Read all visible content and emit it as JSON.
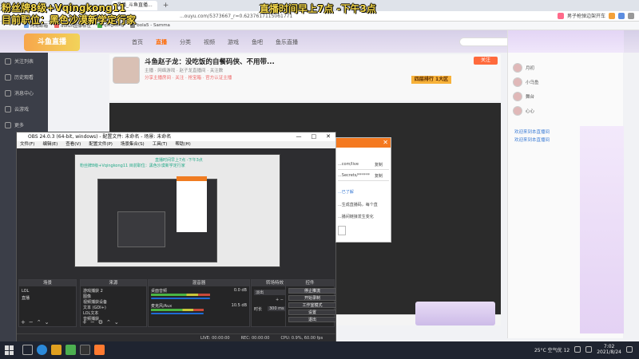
{
  "overlays": {
    "line1": "粉丝牌8级+Vqingkong11",
    "line2": "目前职位：黑色沙漠新学定行家",
    "line3": "直播时间早上7点 -下午3点"
  },
  "browser": {
    "tabs": [
      "混播_斗鱼直播...",
      "+"
    ],
    "url": "...ouyu.com/5373667_r=0.6237617115061771",
    "toolbar_items": [
      "男子枪弹边架开车"
    ],
    "bookmarks": [
      "网易邮箱",
      "dufun图像标注",
      "qingkong",
      "bola5 - Samma"
    ]
  },
  "site": {
    "logo": "斗鱼直播",
    "nav": [
      "首页",
      "直播",
      "分类",
      "视频",
      "游戏",
      "鱼吧",
      "鱼乐直播"
    ],
    "nav_active": 1,
    "left_nav": [
      "关注列表",
      "历史观看",
      "消息中心",
      "云游戏",
      "更多"
    ],
    "room": {
      "title": "斗鱼赵子龙：没吃饭的自餐码侠、不用带...",
      "sub": "主播 · 网络游戏 · 赵子龙直播间 · 关注数",
      "sub2": "分享主播房间 · 关注 · 抢宝箱 · 官方认证主播",
      "follow": "关注",
      "rank": "四层排行 1大区"
    },
    "chat": {
      "ranks": [
        "月初",
        "小乌鱼",
        "舞台",
        "心心"
      ],
      "lines": [
        {
          "user": "欢迎来到本直播间",
          "text": ""
        },
        {
          "user": "欢迎来到本直播间",
          "text": ""
        }
      ]
    }
  },
  "obs": {
    "title": "OBS 24.0.3 (64-bit, windows) - 配置文件: 未命名 - 场景: 未命名",
    "menu": [
      "文件(F)",
      "编辑(E)",
      "查看(V)",
      "配置文件(P)",
      "场景集合(S)",
      "工具(T)",
      "帮助(H)"
    ],
    "preview_text1": "直播时间早上7点 -下午3点",
    "preview_text2": "粉丝牌8级+Vqingkong11 目前职位：黑色沙漠新学定行家",
    "docks": {
      "scenes": {
        "title": "场景",
        "items": [
          "LOL",
          "直播"
        ]
      },
      "sources": {
        "title": "来源",
        "items": [
          "游戏捕获 2",
          "图像",
          "视频捕获设备",
          "文本 (GDI+)",
          "LOL文本",
          "音频捕获"
        ]
      },
      "mixer": {
        "title": "混音器",
        "channels": [
          {
            "name": "桌面音频",
            "db": "0.0 dB",
            "level": 0.62
          },
          {
            "name": "麦克风/Aux",
            "db": "10.5 dB",
            "level": 0.55
          }
        ]
      },
      "transitions": {
        "title": "转场特效",
        "type": "淡出",
        "duration_label": "时长",
        "duration": "300 ms"
      },
      "controls": {
        "title": "控件",
        "buttons": [
          "停止推流",
          "开始录制",
          "工作室模式",
          "设置",
          "退出"
        ]
      }
    },
    "status": [
      "LIVE: 00:00:00",
      "REC: 00:00:00",
      "CPU: 0.9%, 60.00 fps"
    ]
  },
  "dialog": {
    "lines": [
      "...com/live",
      "...Secrets/******",
      "...已了解",
      "...生成直播码，每个直",
      "...播间链接发生变化"
    ],
    "copy": "复制"
  },
  "taskbar": {
    "weather": "25°C 空气优 12",
    "time": "7:02",
    "date": "2021/8/24"
  },
  "colors": {
    "douyu_orange": "#ff6a00",
    "obs_bg": "#2d2d30",
    "overlay_yellow": "#f4d74b",
    "dialog_orange": "#f47920"
  }
}
